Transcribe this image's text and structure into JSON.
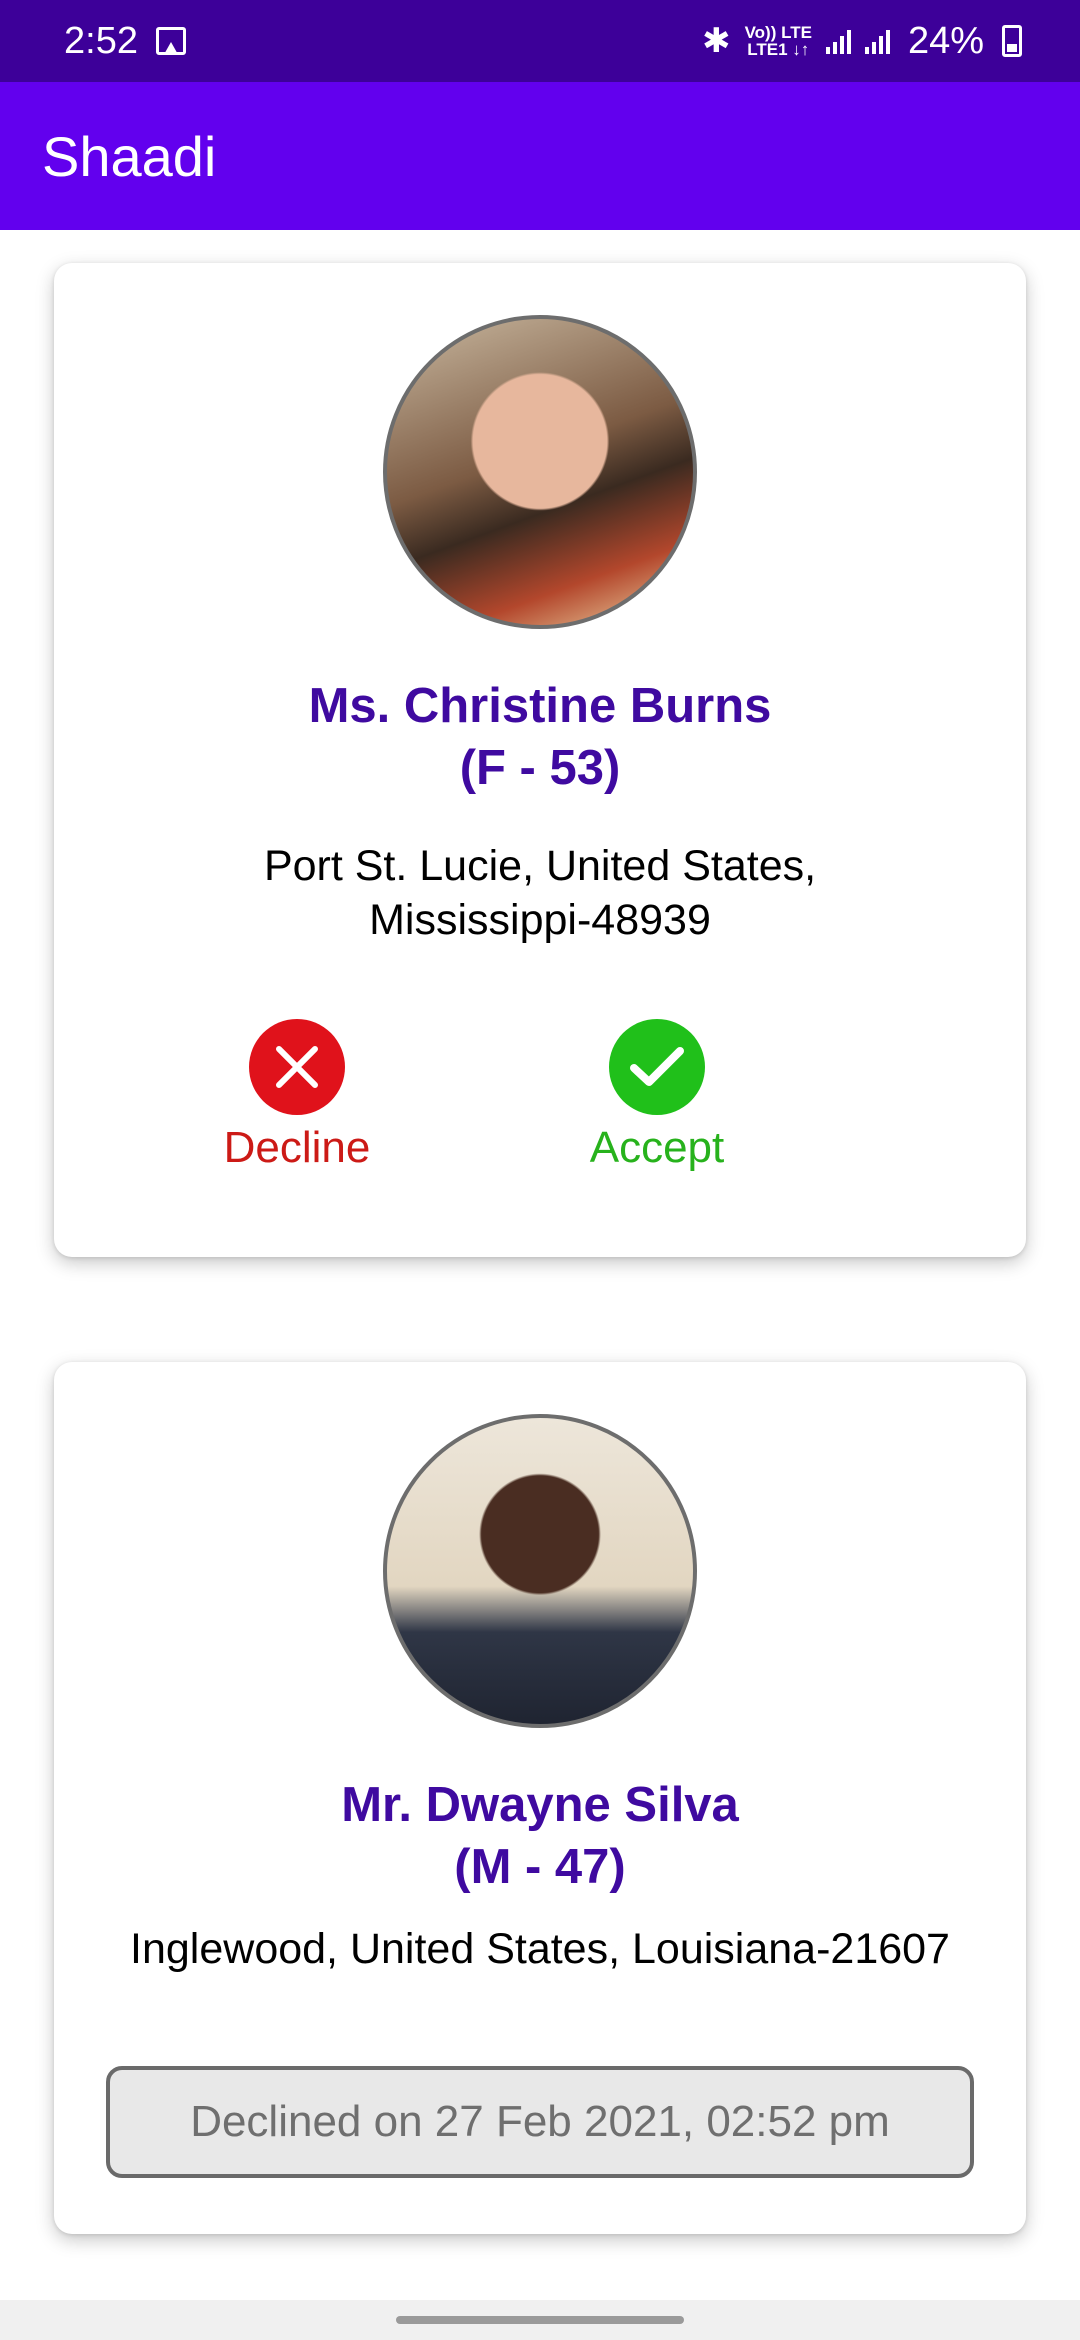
{
  "status_bar": {
    "time": "2:52",
    "network_top": "Vo)) LTE",
    "network_bottom": "LTE1 ↓↑",
    "battery": "24%"
  },
  "app_bar": {
    "title": "Shaadi"
  },
  "profiles": [
    {
      "name": "Ms. Christine Burns",
      "gender_age": "(F - 53)",
      "address_line1": "Port St. Lucie, United States,",
      "address_line2": "Mississippi-48939",
      "decline_label": "Decline",
      "accept_label": "Accept"
    },
    {
      "name": "Mr. Dwayne Silva",
      "gender_age": "(M - 47)",
      "address": "Inglewood, United States, Louisiana-21607",
      "status_text": "Declined on 27 Feb 2021, 02:52 pm"
    }
  ],
  "colors": {
    "status_bar": "#3d0099",
    "app_bar": "#6200ee",
    "name_text": "#3f0aa0",
    "decline": "#e0121b",
    "accept": "#20c01a"
  },
  "icons": [
    "image-icon",
    "bluetooth-icon",
    "signal-icon",
    "battery-icon",
    "close-icon",
    "check-icon"
  ]
}
